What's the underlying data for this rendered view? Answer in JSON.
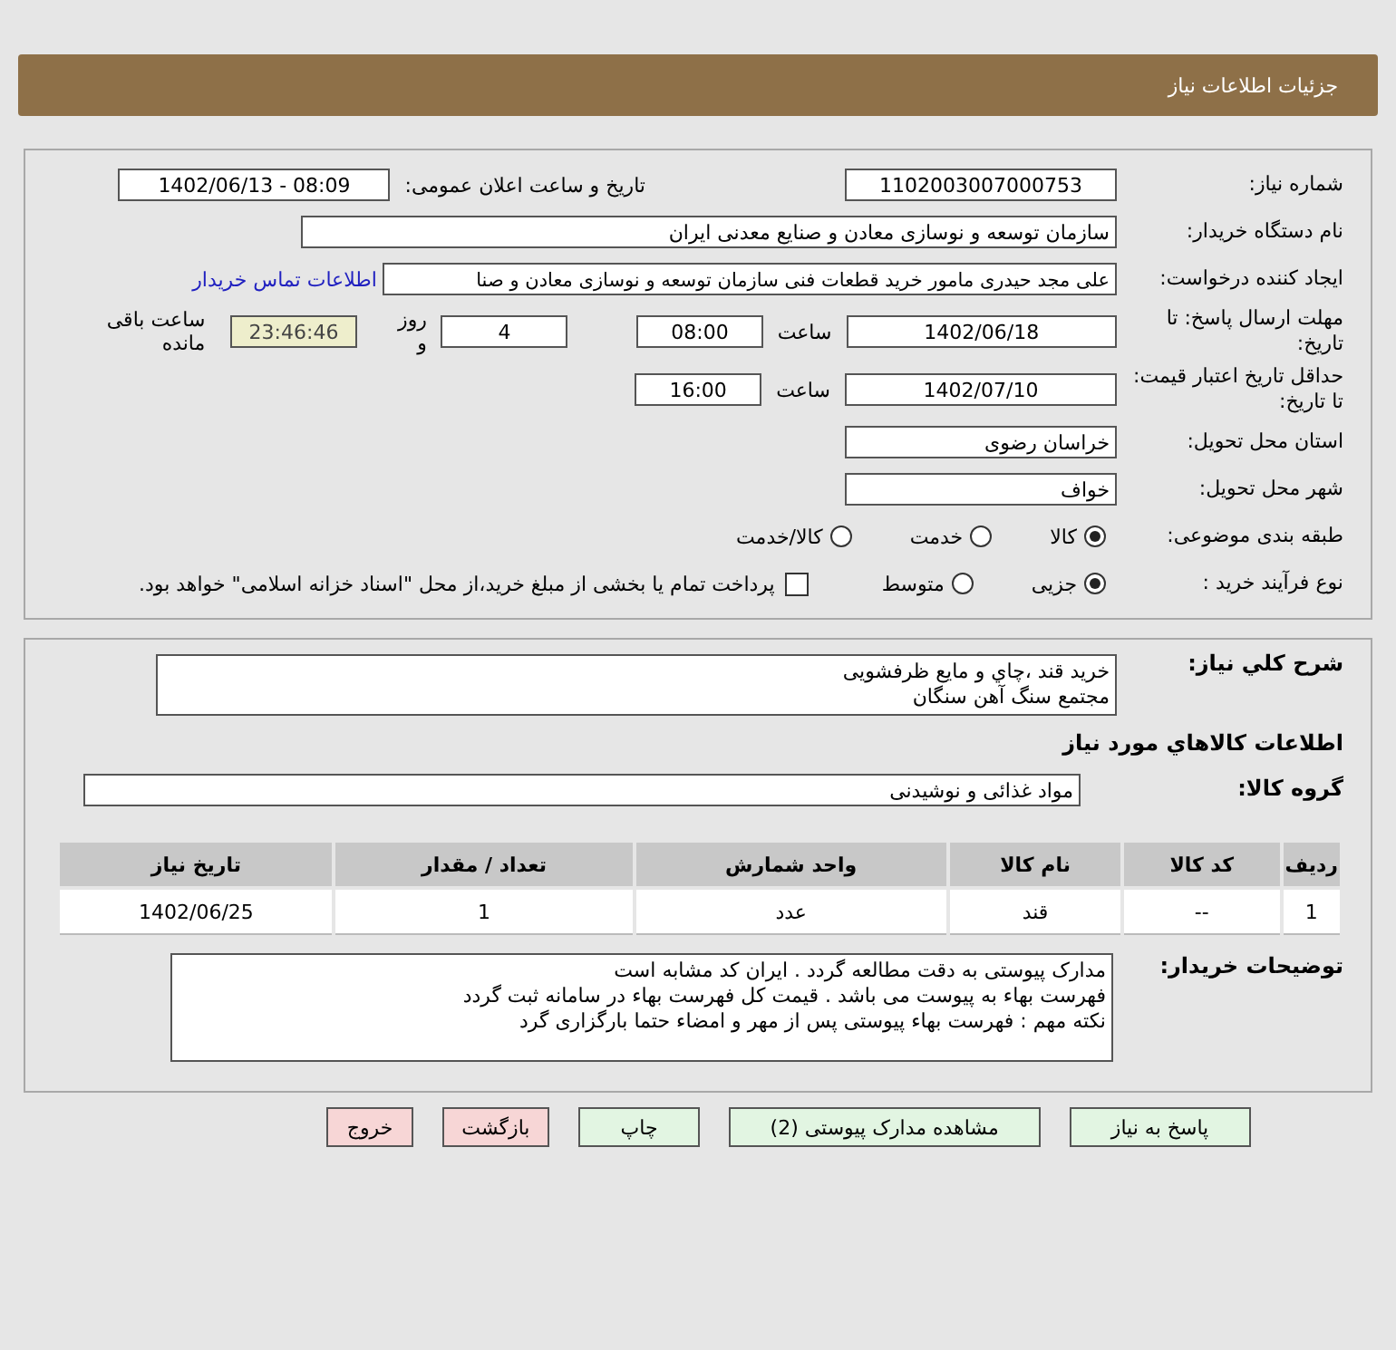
{
  "header": {
    "title": "جزئیات اطلاعات نیاز"
  },
  "details": {
    "need_number": {
      "label": "شماره نیاز:",
      "value": "1102003007000753"
    },
    "announce": {
      "label": "تاریخ و ساعت اعلان عمومی:",
      "value": "1402/06/13 - 08:09"
    },
    "buyer_org": {
      "label": "نام دستگاه خریدار:",
      "value": "سازمان توسعه و نوسازی معادن و صنایع معدنی ایران"
    },
    "creator": {
      "label": "ایجاد کننده درخواست:",
      "value": "علی مجد حیدری مامور خرید قطعات فنی سازمان توسعه و نوسازی معادن و صنا",
      "link": "اطلاعات تماس خریدار"
    },
    "deadline": {
      "label": "مهلت ارسال پاسخ: تا تاریخ:",
      "date": "1402/06/18",
      "time_label": "ساعت",
      "time": "08:00",
      "days": "4",
      "days_label": "روز و",
      "remaining": "23:46:46",
      "remaining_label": "ساعت باقی مانده"
    },
    "validity": {
      "label": "حداقل تاریخ اعتبار قیمت: تا تاریخ:",
      "date": "1402/07/10",
      "time_label": "ساعت",
      "time": "16:00"
    },
    "province": {
      "label": "استان محل تحویل:",
      "value": "خراسان رضوی"
    },
    "city": {
      "label": "شهر محل تحویل:",
      "value": "خواف"
    },
    "category": {
      "label": "طبقه بندی موضوعی:",
      "options": [
        {
          "label": "کالا",
          "selected": true
        },
        {
          "label": "خدمت",
          "selected": false
        },
        {
          "label": "کالا/خدمت",
          "selected": false
        }
      ]
    },
    "process": {
      "label": "نوع فرآیند خرید :",
      "options": [
        {
          "label": "جزیی",
          "selected": true
        },
        {
          "label": "متوسط",
          "selected": false
        }
      ],
      "payment": {
        "label": "پرداخت تمام یا بخشی از مبلغ خرید،از محل \"اسناد خزانه اسلامی\" خواهد بود.",
        "checked": false
      }
    }
  },
  "summary": {
    "label": "شرح کلي نياز:",
    "lines": [
      "خريد قند ،چاي و مايع ظرفشويی",
      "مجتمع سنگ آهن سنگان"
    ]
  },
  "goods_title": "اطلاعات كالاهاي مورد نياز",
  "goods_group": {
    "label": "گروه کالا:",
    "value": "مواد غذائی و نوشیدنی"
  },
  "table": {
    "columns": [
      "ردیف",
      "کد کالا",
      "نام کالا",
      "واحد شمارش",
      "تعداد / مقدار",
      "تاریخ نیاز"
    ],
    "rows": [
      [
        "1",
        "--",
        "قند",
        "عدد",
        "1",
        "1402/06/25"
      ]
    ]
  },
  "notes": {
    "label": "توضیحات خریدار:",
    "lines": [
      "مدارک پیوستی به دقت مطالعه گردد . ایران کد مشابه است",
      "فهرست بهاء به پیوست می باشد . قیمت کل فهرست بهاء در سامانه ثبت گردد",
      "نکته مهم : فهرست بهاء پیوستی پس از مهر و امضاء حتما بارگزاری گرد"
    ]
  },
  "buttons": [
    {
      "label": "پاسخ به نیاز",
      "kind": "action"
    },
    {
      "label": "مشاهده مدارک پیوستی (2)",
      "kind": "action"
    },
    {
      "label": "چاپ",
      "kind": "action"
    },
    {
      "label": "بازگشت",
      "kind": "exit"
    },
    {
      "label": "خروج",
      "kind": "exit"
    }
  ]
}
